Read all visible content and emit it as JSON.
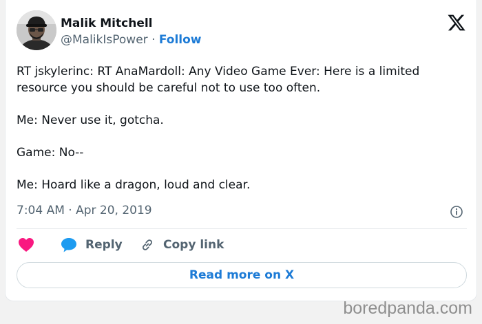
{
  "author": {
    "name": "Malik Mitchell",
    "handle": "@MalikIsPower",
    "separator": "·",
    "follow_label": "Follow"
  },
  "tweet": {
    "paragraphs": [
      "RT jskylerinc: RT AnaMardoll: Any Video Game Ever: Here is a limited resource you should be careful not to use too often.",
      "Me: Never use it, gotcha.",
      "Game: No--",
      "Me: Hoard like a dragon, loud and clear."
    ],
    "timestamp": "7:04 AM · Apr 20, 2019"
  },
  "actions": {
    "like_icon": "heart-icon",
    "reply_label": "Reply",
    "reply_icon": "speech-bubble-icon",
    "copy_label": "Copy link",
    "copy_icon": "link-icon",
    "read_more_label": "Read more on X"
  },
  "icons": {
    "platform": "x-logo-icon",
    "info": "info-icon"
  },
  "colors": {
    "accent": "#1d7bd6",
    "heart": "#f91880",
    "reply_bubble": "#1d9bf0",
    "secondary_text": "#536471"
  },
  "watermark": "boredpanda.com"
}
